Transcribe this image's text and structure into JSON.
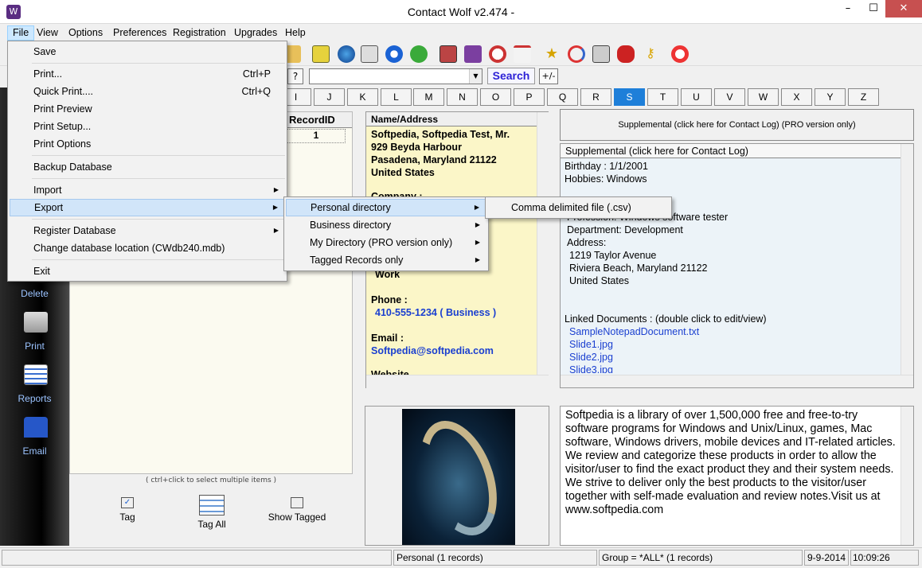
{
  "titlebar": {
    "title": "Contact Wolf v2.474 -",
    "min": "–",
    "max": "☐",
    "close": "✕"
  },
  "menubar": [
    "File",
    "View",
    "Options",
    "Preferences",
    "Registration",
    "Upgrades",
    "Help"
  ],
  "file_menu": {
    "save": "Save",
    "print": "Print...",
    "print_sc": "Ctrl+P",
    "quick_print": "Quick Print....",
    "quick_print_sc": "Ctrl+Q",
    "print_preview": "Print Preview",
    "print_setup": "Print Setup...",
    "print_options": "Print Options",
    "backup": "Backup Database",
    "import": "Import",
    "export": "Export",
    "register_db": "Register Database",
    "change_loc": "Change database location (CWdb240.mdb)",
    "exit": "Exit"
  },
  "export_menu": [
    "Personal directory",
    "Business directory",
    "My Directory (PRO version only)",
    "Tagged Records only"
  ],
  "personal_submenu": [
    "Comma delimited file (.csv)"
  ],
  "searchrow": {
    "help": "?",
    "search_label": "Search",
    "plusminus": "+/-"
  },
  "alphabet": [
    "I",
    "J",
    "K",
    "L",
    "M",
    "N",
    "O",
    "P",
    "Q",
    "R",
    "S",
    "T",
    "U",
    "V",
    "W",
    "X",
    "Y",
    "Z"
  ],
  "alphabet_selected": "S",
  "sidebar": {
    "delete": "Delete",
    "print": "Print",
    "reports": "Reports",
    "email": "Email"
  },
  "records": {
    "header": "RecordID",
    "value": "1",
    "hint": "( ctrl+click to select multiple items )"
  },
  "tag_buttons": {
    "tag": "Tag",
    "tag_all": "Tag All",
    "show_tagged": "Show Tagged"
  },
  "name_panel": {
    "header": "Name/Address",
    "line1": "Softpedia, Softpedia Test, Mr.",
    "line2": "929 Beyda Harbour",
    "line3": "Pasadena, Maryland  21122",
    "line4": "United States",
    "company_cut": "Company :",
    "work": "Work",
    "phone_label": "Phone :",
    "phone": "410-555-1234 ( Business )",
    "email_label": "Email :",
    "email": "Softpedia@softpedia.com",
    "website_cut": "Website"
  },
  "supplemental": {
    "button": "Supplemental (click here for Contact Log) (PRO version only)",
    "header": "Supplemental (click here for Contact Log)",
    "birthday": "Birthday :   1/1/2001",
    "hobbies": "Hobbies:  Windows",
    "profession": "Profession:  Windows software tester",
    "department": "Department:  Development",
    "address_label": "Address:",
    "addr1": "1219 Taylor Avenue",
    "addr2": "Riviera Beach, Maryland  21122",
    "addr3": "United States",
    "linked": "Linked Documents : (double click to edit/view)",
    "docs": [
      "SampleNotepadDocument.txt",
      "Slide1.jpg",
      "Slide2.jpg",
      "Slide3.jpg"
    ]
  },
  "description": "Softpedia is a library of over 1,500,000 free and free-to-try software programs for Windows and Unix/Linux, games,  Mac software, Windows drivers, mobile devices and IT-related articles. We review and categorize these products in order to allow the visitor/user to find the exact product they and  their system needs.  We strive to deliver only the best products to the visitor/user together with self-made evaluation and review notes.Visit us at www.softpedia.com",
  "statusbar": {
    "mode": "Personal (1 records)",
    "group": "Group = *ALL* (1 records)",
    "date": "9-9-2014",
    "time": "10:09:26"
  },
  "colors": {
    "accent": "#1e7fd9",
    "name_bg": "#fbf6c8",
    "link_blue": "#1a3fd0",
    "close_red": "#c75050"
  }
}
